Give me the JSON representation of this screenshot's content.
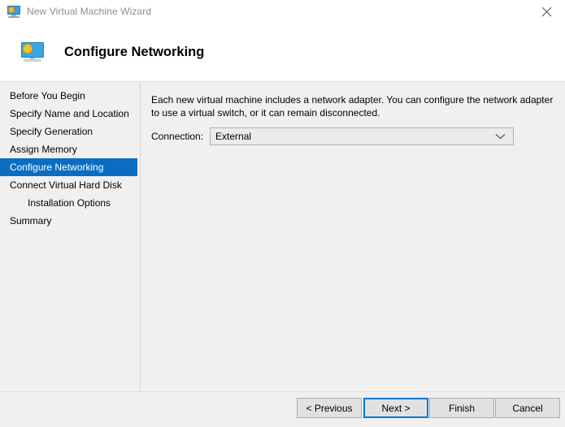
{
  "window": {
    "title": "New Virtual Machine Wizard",
    "title_icon": "virtual-machine-monitor-icon",
    "close_icon": "close-icon"
  },
  "header": {
    "title": "Configure Networking",
    "icon": "virtual-machine-monitor-icon"
  },
  "sidebar": {
    "items": [
      {
        "label": "Before You Begin",
        "selected": false,
        "indented": false
      },
      {
        "label": "Specify Name and Location",
        "selected": false,
        "indented": false
      },
      {
        "label": "Specify Generation",
        "selected": false,
        "indented": false
      },
      {
        "label": "Assign Memory",
        "selected": false,
        "indented": false
      },
      {
        "label": "Configure Networking",
        "selected": true,
        "indented": false
      },
      {
        "label": "Connect Virtual Hard Disk",
        "selected": false,
        "indented": false
      },
      {
        "label": "Installation Options",
        "selected": false,
        "indented": true
      },
      {
        "label": "Summary",
        "selected": false,
        "indented": false
      }
    ]
  },
  "main": {
    "description": "Each new virtual machine includes a network adapter. You can configure the network adapter to use a virtual switch, or it can remain disconnected.",
    "connection_label": "Connection:",
    "connection_value": "External",
    "connection_arrow_icon": "chevron-down-icon"
  },
  "footer": {
    "previous_label": "< Previous",
    "next_label": "Next >",
    "finish_label": "Finish",
    "cancel_label": "Cancel"
  },
  "colors": {
    "selection_blue": "#0a6dc2",
    "focus_blue": "#0078d7",
    "window_background": "#f0f0f0",
    "header_background": "#ffffff",
    "title_text": "#8d8d8d"
  }
}
